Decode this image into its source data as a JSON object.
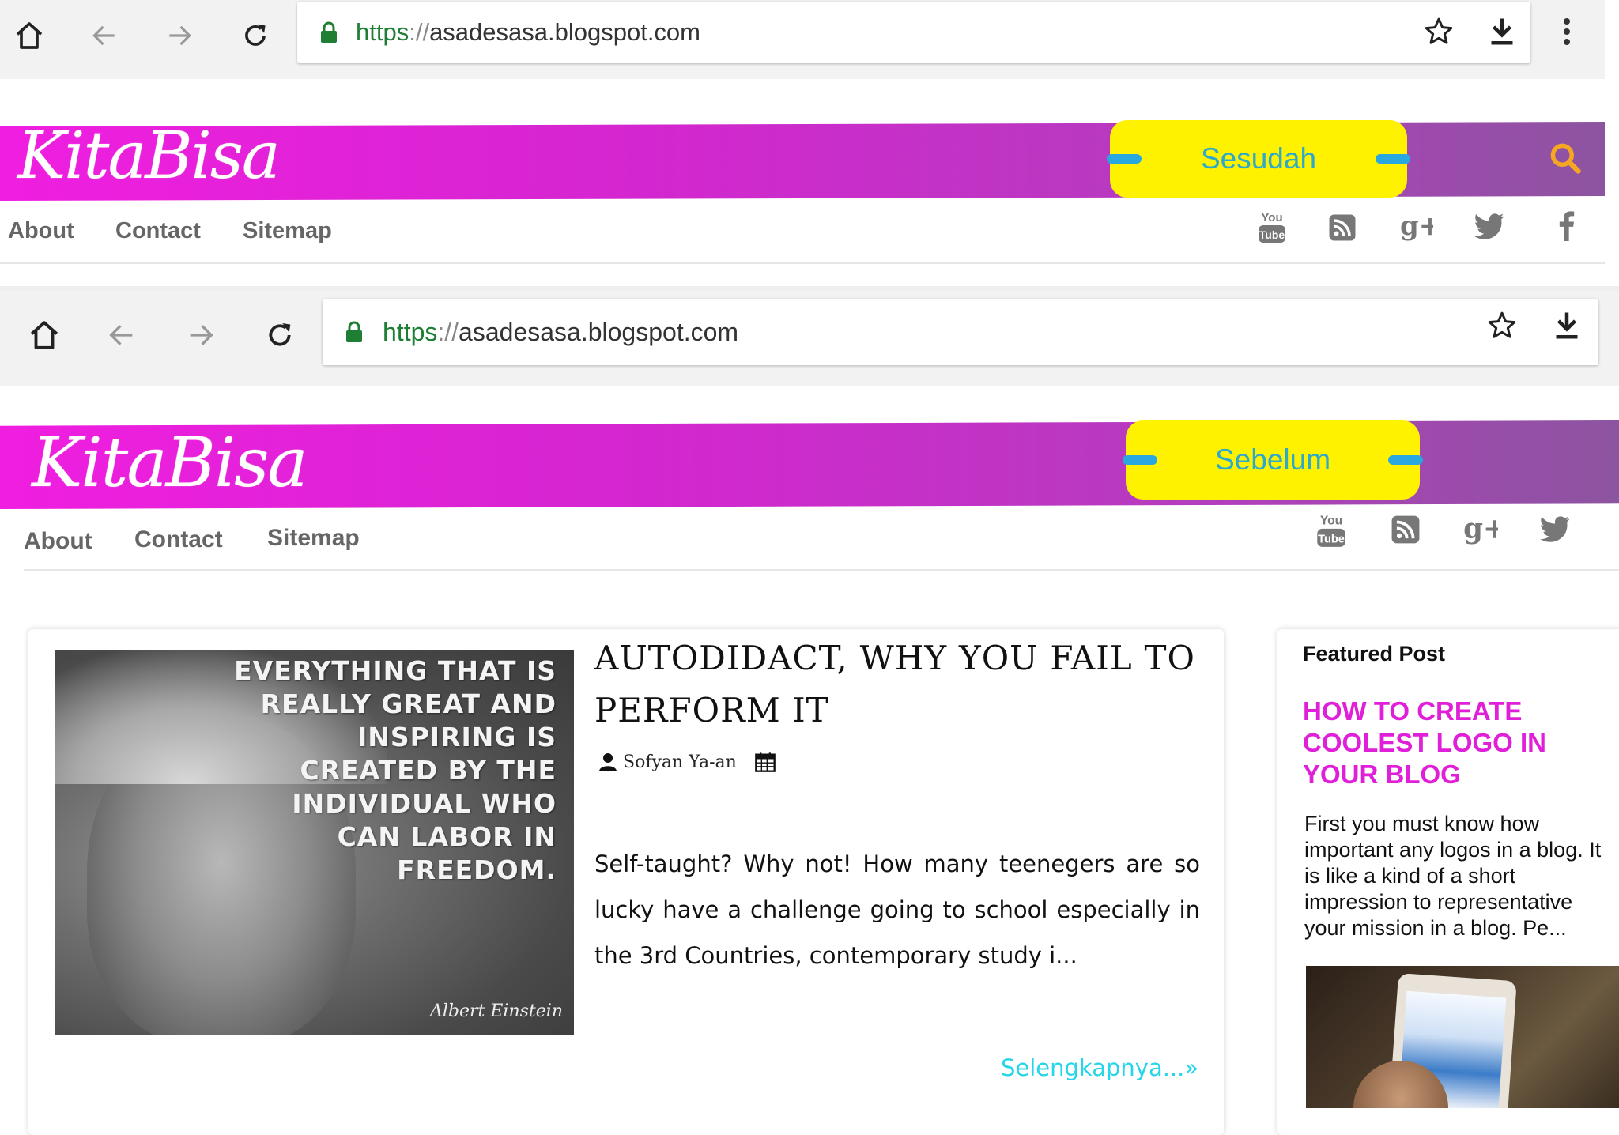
{
  "top_browser": {
    "url_scheme": "https",
    "url_sep": "://",
    "url_host": "asadesasa.blogspot.com"
  },
  "top_site": {
    "logo": "KitaBisa",
    "tag_label": "Sesudah",
    "nav": [
      "About",
      "Contact",
      "Sitemap"
    ],
    "social_icons": [
      "youtube-icon",
      "rss-icon",
      "google-plus-icon",
      "twitter-icon",
      "facebook-icon"
    ]
  },
  "bottom_browser": {
    "url_scheme": "https",
    "url_sep": "://",
    "url_host": "asadesasa.blogspot.com"
  },
  "bottom_site": {
    "logo": "KitaBisa",
    "tag_label": "Sebelum",
    "nav": [
      "About",
      "Contact",
      "Sitemap"
    ],
    "social_icons": [
      "youtube-icon",
      "rss-icon",
      "google-plus-icon",
      "twitter-icon"
    ]
  },
  "youtube_label": {
    "top": "You",
    "bottom": "Tube"
  },
  "google_plus_label": "g+",
  "post": {
    "title": "AUTODIDACT, WHY YOU FAIL TO PERFORM IT",
    "author": "Sofyan Ya-an",
    "excerpt": "Self-taught? Why not! How many teenegers are so lucky have a challenge going to school especially in the 3rd Countries, contemporary study i...",
    "read_more": "Selengkapnya...»",
    "image_quote": "EVERYTHING THAT IS\nREALLY GREAT AND\nINSPIRING IS\nCREATED BY THE\nINDIVIDUAL WHO\nCAN LABOR IN\nFREEDOM.",
    "image_author": "Albert Einstein"
  },
  "sidebar": {
    "heading": "Featured Post",
    "title": "HOW TO CREATE COOLEST LOGO IN YOUR BLOG",
    "text": "First you must know how important any logos in a blog. It is like a kind of a short impression to representative your mission in a blog. Pe..."
  },
  "colors": {
    "brand_magenta": "#f01ee0",
    "tag_yellow": "#fff200",
    "tag_text": "#2ea9c9",
    "read_more": "#25d5e8",
    "sidebar_title": "#e020d8",
    "search_icon": "#f5a623"
  }
}
